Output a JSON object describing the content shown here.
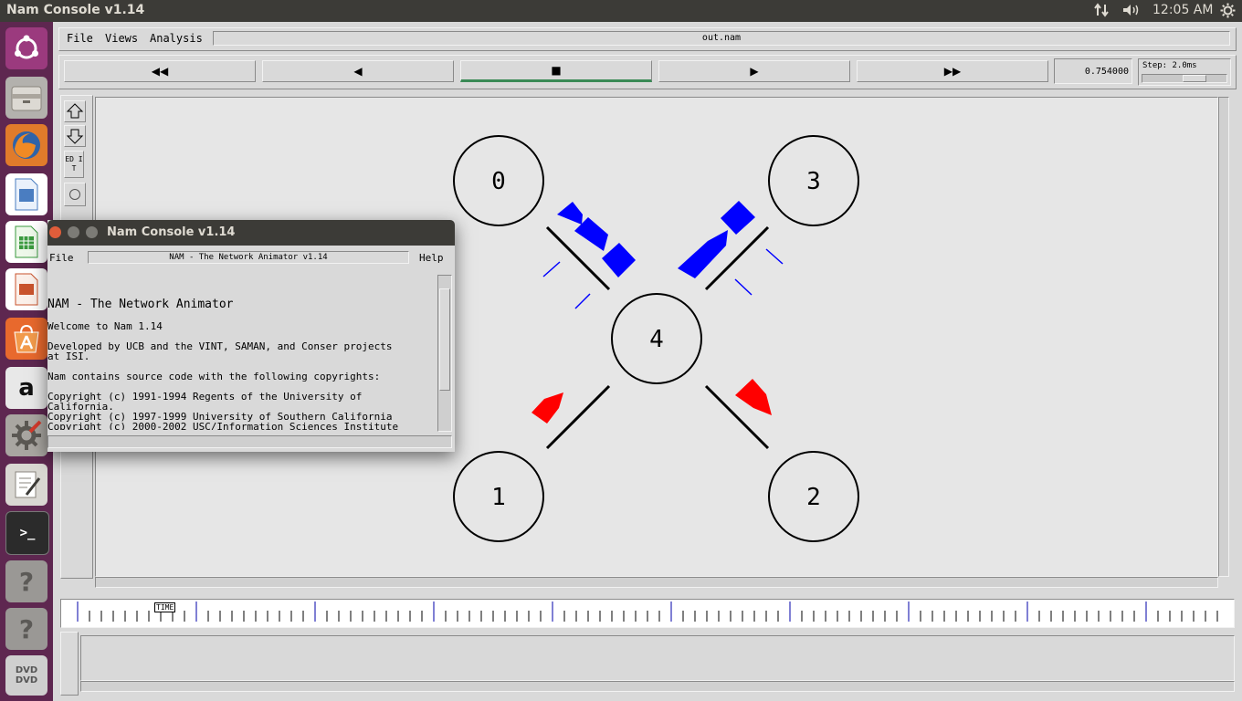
{
  "topbar": {
    "app_title": "Nam Console v1.14",
    "clock": "12:05 AM",
    "icons": [
      "network-arrows-icon",
      "volume-icon",
      "settings-gear-icon"
    ]
  },
  "launcher": {
    "items": [
      "ubuntu-dash-icon",
      "files-icon",
      "firefox-icon",
      "writer-icon",
      "calc-icon",
      "impress-icon",
      "software-center-icon",
      "amazon-icon",
      "system-settings-icon",
      "text-editor-icon",
      "terminal-icon",
      "unknown-app-icon",
      "unknown-app-icon",
      "dvd-icon"
    ],
    "amazon_glyph": "a",
    "unknown_glyph": "?",
    "terminal_glyph": ">_",
    "dvd_label": "DVD"
  },
  "nam": {
    "menu": {
      "file": "File",
      "views": "Views",
      "analysis": "Analysis"
    },
    "trace_file": "out.nam",
    "controls": {
      "rewind": "◀◀",
      "back": "◀",
      "stop": "■",
      "play": "▶",
      "fast_forward": "▶▶",
      "time": "0.754000",
      "step": "Step: 2.0ms",
      "step_slider_fraction": 0.65
    },
    "tools": {
      "zoom_in": "zoom-in-icon",
      "zoom_out": "zoom-out-icon",
      "edit": "ED IT"
    },
    "timeline": {
      "label": "TIME"
    },
    "colors": {
      "packet_blue": "#0000ff",
      "packet_red": "#ff0000",
      "play_active": "#3a8a56"
    },
    "nodes": [
      {
        "id": "0"
      },
      {
        "id": "1"
      },
      {
        "id": "2"
      },
      {
        "id": "3"
      },
      {
        "id": "4"
      }
    ]
  },
  "console": {
    "title": "Nam Console v1.14",
    "menu_file": "File",
    "menu_help": "Help",
    "header_label": "NAM - The Network Animator v1.14",
    "lines": [
      "NAM - The Network Animator",
      "Welcome to Nam 1.14",
      "Developed by UCB and the VINT, SAMAN, and Conser projects",
      "at ISI.",
      "Nam contains source code with the following copyrights:",
      "Copyright (c) 1991-1994 Regents of the University of",
      "California.",
      "Copyright (c) 1997-1999 University of Southern California",
      "Copyright (c) 2000-2002 USC/Information Sciences Institute"
    ]
  }
}
